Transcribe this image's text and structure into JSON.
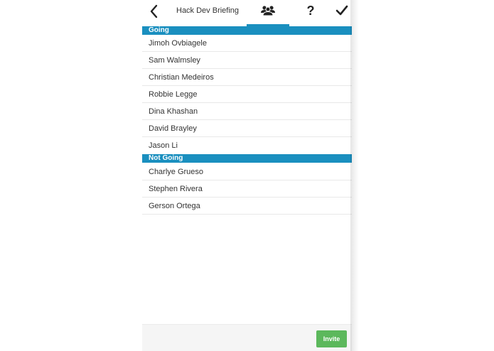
{
  "header": {
    "title": "Hack Dev Briefing",
    "help_label": "?"
  },
  "sections": [
    {
      "label": "Going",
      "people": [
        "Jimoh Ovbiagele",
        "Sam Walmsley",
        "Christian Medeiros",
        "Robbie Legge",
        "Dina Khashan",
        "David Brayley",
        "Jason Li"
      ]
    },
    {
      "label": "Not Going",
      "people": [
        "Charlye Grueso",
        "Stephen Rivera",
        "Gerson Ortega"
      ]
    }
  ],
  "footer": {
    "invite_label": "Invite"
  },
  "colors": {
    "accent": "#1a8fbf",
    "invite": "#5cb85c"
  },
  "icons": {
    "back": "chevron-left-icon",
    "attendees": "people-group-icon",
    "help": "question-mark-icon",
    "done": "checkmark-icon"
  }
}
